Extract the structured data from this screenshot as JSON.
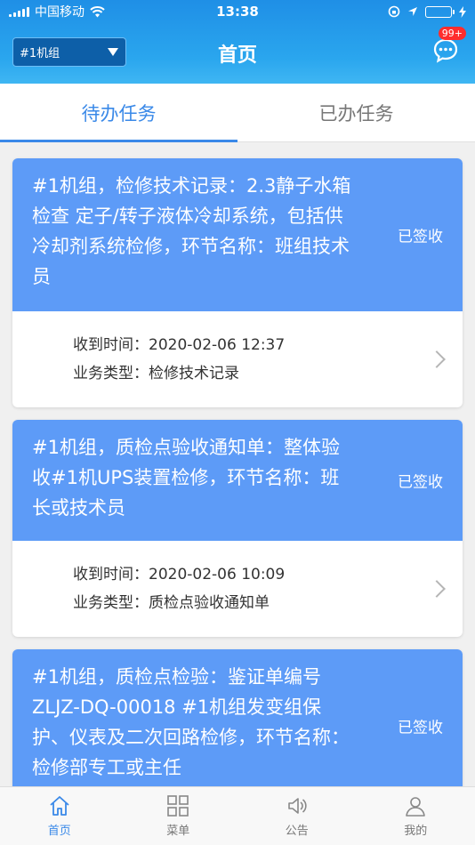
{
  "status_bar": {
    "carrier": "中国移动",
    "time": "13:38"
  },
  "header": {
    "unit_selected": "#1机组",
    "title": "首页",
    "message_badge": "99+"
  },
  "tabs": [
    {
      "label": "待办任务",
      "active": true
    },
    {
      "label": "已办任务",
      "active": false
    }
  ],
  "labels": {
    "received_time": "收到时间：",
    "business_type": "业务类型："
  },
  "tasks": [
    {
      "title": "#1机组，检修技术记录：2.3静子水箱检查 定子/转子液体冷却系统，包括供冷却剂系统检修，环节名称：班组技术员",
      "status": "已签收",
      "received_time": "2020-02-06 12:37",
      "business_type": "检修技术记录"
    },
    {
      "title": "#1机组，质检点验收通知单：整体验收#1机UPS装置检修，环节名称：班长或技术员",
      "status": "已签收",
      "received_time": "2020-02-06 10:09",
      "business_type": "质检点验收通知单"
    },
    {
      "title": "#1机组，质检点检验：鉴证单编号 ZLJZ-DQ-00018 #1机组发变组保护、仪表及二次回路检修，环节名称：检修部专工或主任",
      "status": "已签收"
    }
  ],
  "tabbar": [
    {
      "label": "首页",
      "icon": "home-icon",
      "active": true
    },
    {
      "label": "菜单",
      "icon": "grid-menu-icon",
      "active": false
    },
    {
      "label": "公告",
      "icon": "speaker-icon",
      "active": false
    },
    {
      "label": "我的",
      "icon": "user-icon",
      "active": false
    }
  ],
  "colors": {
    "header": "#2196ea",
    "card_head": "#5d9bf7",
    "accent": "#3a89e8",
    "badge": "#ff2d2d"
  }
}
